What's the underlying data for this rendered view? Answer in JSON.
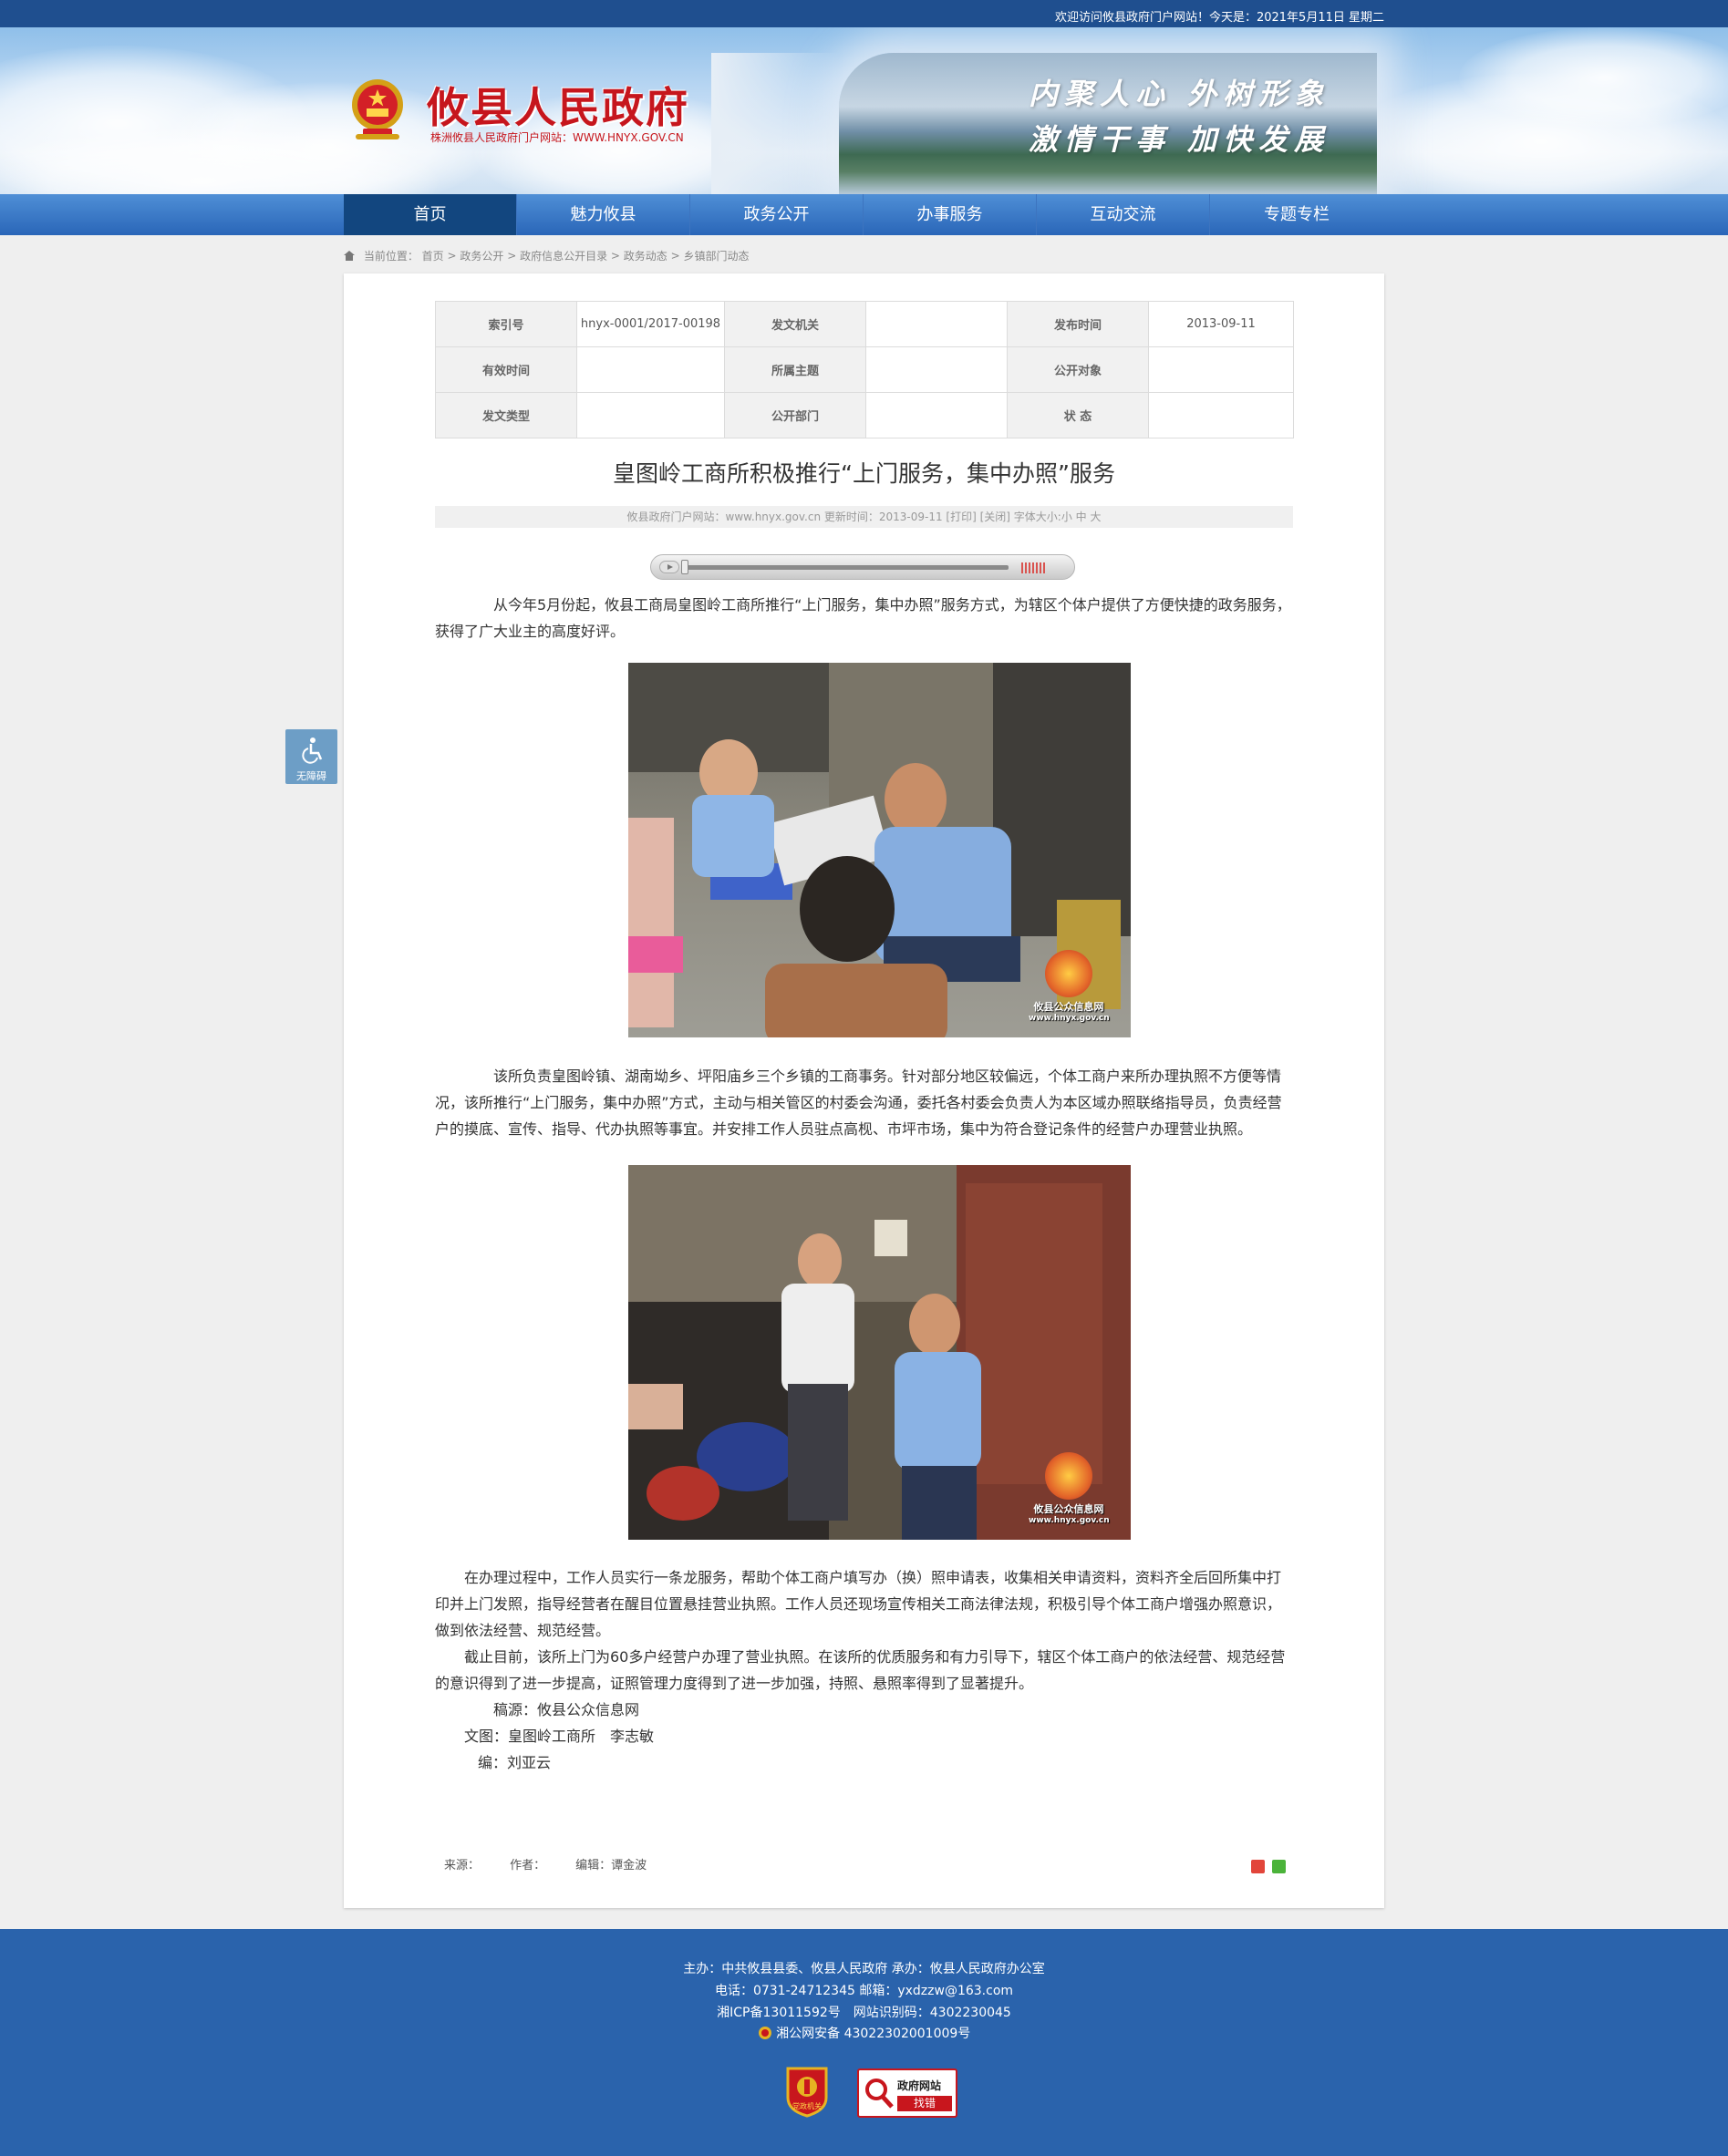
{
  "topbar": {
    "welcome": "欢迎访问攸县政府门户网站！今天是：2021年5月11日 星期二"
  },
  "header": {
    "site_title": "攸县人民政府",
    "site_subtitle": "株洲攸县人民政府门户网站：WWW.HNYX.GOV.CN",
    "slogan_line1": "内聚人心 外树形象",
    "slogan_line2": "激情干事 加快发展"
  },
  "nav": {
    "items": [
      {
        "label": "首页",
        "active": true
      },
      {
        "label": "魅力攸县"
      },
      {
        "label": "政务公开"
      },
      {
        "label": "办事服务"
      },
      {
        "label": "互动交流"
      },
      {
        "label": "专题专栏"
      }
    ]
  },
  "breadcrumb": {
    "prefix": "当前位置：",
    "path": [
      "首页",
      "政务公开",
      "政府信息公开目录",
      "政务动态",
      "乡镇部门动态"
    ],
    "sep": " > "
  },
  "meta": {
    "rows": [
      [
        {
          "k": "索引号",
          "v": "hnyx-0001/2017-00198"
        },
        {
          "k": "发文机关",
          "v": ""
        },
        {
          "k": "发布时间",
          "v": "2013-09-11"
        }
      ],
      [
        {
          "k": "有效时间",
          "v": ""
        },
        {
          "k": "所属主题",
          "v": ""
        },
        {
          "k": "公开对象",
          "v": ""
        }
      ],
      [
        {
          "k": "发文类型",
          "v": ""
        },
        {
          "k": "公开部门",
          "v": ""
        },
        {
          "k": "状 态",
          "v": ""
        }
      ]
    ]
  },
  "article": {
    "title": "皇图岭工商所积极推行“上门服务，集中办照”服务",
    "info": "攸县政府门户网站：www.hnyx.gov.cn  更新时间：2013-09-11  [打印] [关闭]  字体大小:小 中 大",
    "p1": "从今年5月份起，攸县工商局皇图岭工商所推行“上门服务，集中办照”服务方式，为辖区个体户提供了方便快捷的政务服务，获得了广大业主的高度好评。",
    "p2": "该所负责皇图岭镇、湖南坳乡、坪阳庙乡三个乡镇的工商事务。针对部分地区较偏远，个体工商户来所办理执照不方便等情况，该所推行“上门服务，集中办照”方式，主动与相关管区的村委会沟通，委托各村委会负责人为本区域办照联络指导员，负责经营户的摸底、宣传、指导、代办执照等事宜。并安排工作人员驻点高枧、市坪市场，集中为符合登记条件的经营户办理营业执照。",
    "p3": "在办理过程中，工作人员实行一条龙服务，帮助个体工商户填写办（换）照申请表，收集相关申请资料，资料齐全后回所集中打印并上门发照，指导经营者在醒目位置悬挂营业执照。工作人员还现场宣传相关工商法律法规，积极引导个体工商户增强办照意识，做到依法经营、规范经营。",
    "p4": "截止目前，该所上门为60多户经营户办理了营业执照。在该所的优质服务和有力引导下，辖区个体工商户的依法经营、规范经营的意识得到了进一步提高，证照管理力度得到了进一步加强，持照、悬照率得到了显著提升。",
    "credit_source": "稿源：攸县公众信息网",
    "credit_text": "文图：皇图岭工商所　李志敏",
    "credit_editor": "编：刘亚云",
    "watermark": "攸县公众信息网",
    "watermark_url": "www.hnyx.gov.cn"
  },
  "article_footer": {
    "source": "来源：",
    "author": "作者：",
    "editor": "编辑：谭金波"
  },
  "accessibility": {
    "label": "无障碍"
  },
  "footer": {
    "line1": "主办：中共攸县县委、攸县人民政府 承办：攸县人民政府办公室",
    "line2": "电话：0731-24712345 邮箱：yxdzzw@163.com",
    "line3": "湘ICP备13011592号　网站识别码：4302230045",
    "line4": "湘公网安备 43022302001009号",
    "badge1": "党政机关",
    "badge2_title": "政府网站",
    "badge2_sub": "找错"
  },
  "colors": {
    "brand_blue": "#2a63ac",
    "title_red": "#c6161d",
    "nav_active": "#12467f"
  }
}
